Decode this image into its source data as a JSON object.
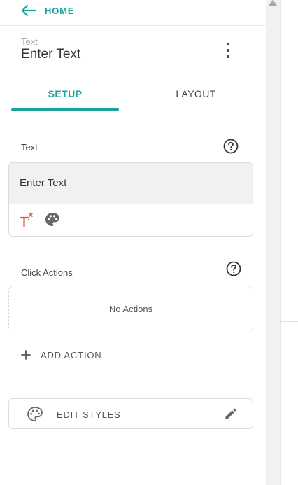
{
  "header": {
    "back_label": "HOME",
    "component_kind": "Text",
    "component_title": "Enter Text"
  },
  "tabs": [
    {
      "label": "SETUP",
      "active": true
    },
    {
      "label": "LAYOUT",
      "active": false
    }
  ],
  "text_section": {
    "label": "Text",
    "value": "Enter Text"
  },
  "click_actions": {
    "label": "Click Actions",
    "empty_text": "No Actions",
    "add_label": "ADD ACTION"
  },
  "edit_styles": {
    "label": "EDIT STYLES"
  },
  "colors": {
    "accent": "#1aa39a",
    "magic_icon": "#e8532f",
    "text_box_bg": "#f1f1f1"
  },
  "icons": {
    "back": "arrow-left-icon",
    "more": "more-vertical-icon",
    "help": "help-circle-icon",
    "magic_text": "magic-text-icon",
    "palette": "palette-icon",
    "add": "plus-icon",
    "edit": "pencil-icon"
  }
}
